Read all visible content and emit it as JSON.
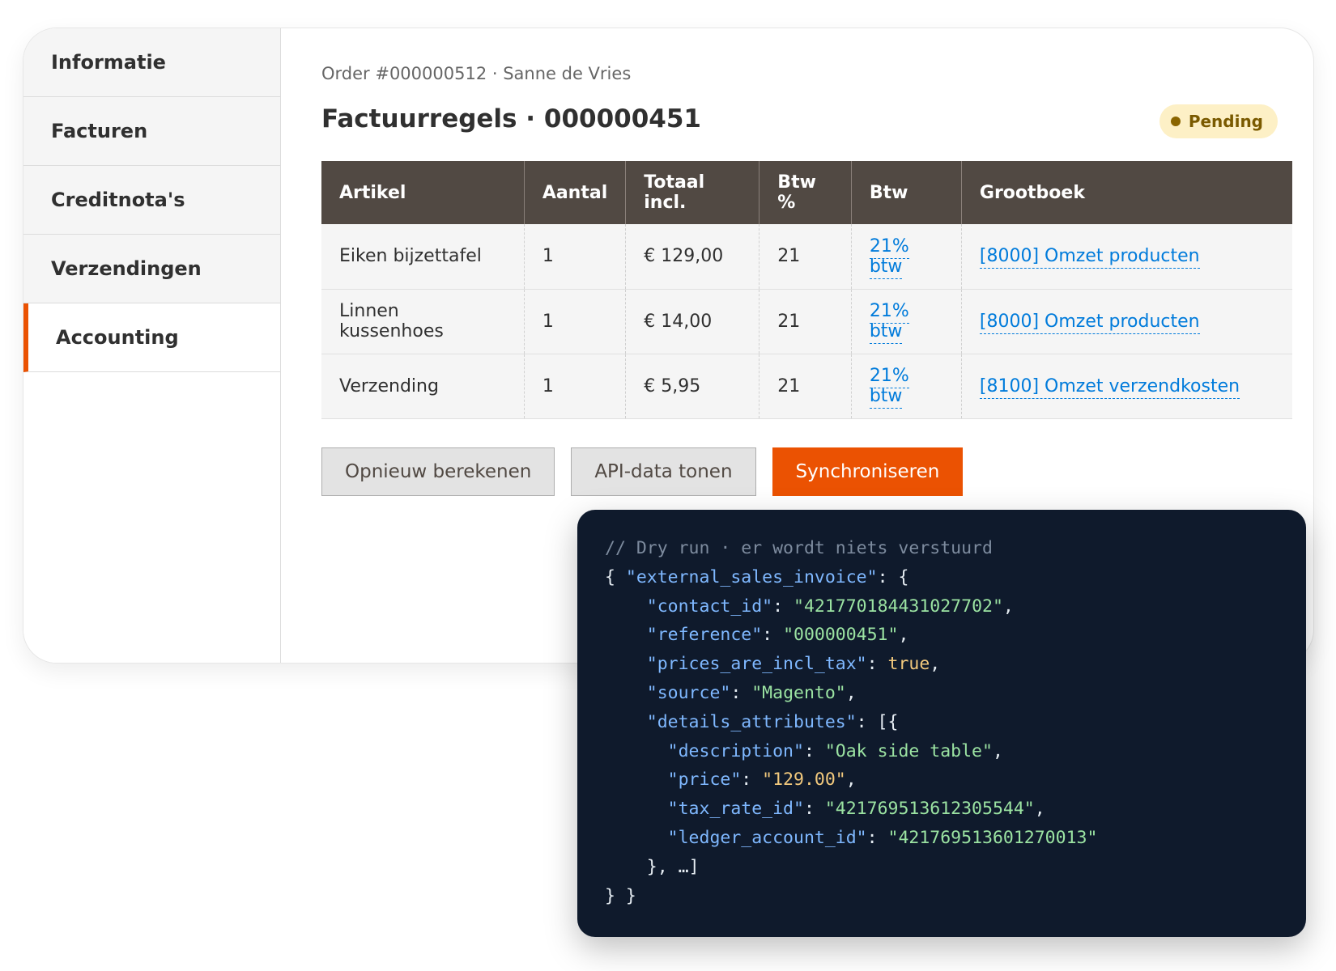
{
  "sidebar": {
    "items": [
      {
        "label": "Informatie"
      },
      {
        "label": "Facturen"
      },
      {
        "label": "Creditnota's"
      },
      {
        "label": "Verzendingen"
      },
      {
        "label": "Accounting"
      }
    ],
    "active": "Accounting"
  },
  "header": {
    "breadcrumb": "Order #000000512 · Sanne de Vries",
    "title": "Factuurregels · 000000451",
    "status": "Pending"
  },
  "table": {
    "columns": [
      "Artikel",
      "Aantal",
      "Totaal incl.",
      "Btw %",
      "Btw",
      "Grootboek"
    ],
    "rows": [
      {
        "artikel": "Eiken bijzettafel",
        "aantal": "1",
        "totaal": "€ 129,00",
        "btw_pct": "21",
        "btw": "21% btw",
        "grootboek": "[8000] Omzet producten"
      },
      {
        "artikel": "Linnen kussenhoes",
        "aantal": "1",
        "totaal": "€ 14,00",
        "btw_pct": "21",
        "btw": "21% btw",
        "grootboek": "[8000] Omzet producten"
      },
      {
        "artikel": "Verzending",
        "aantal": "1",
        "totaal": "€ 5,95",
        "btw_pct": "21",
        "btw": "21% btw",
        "grootboek": "[8100] Omzet verzendkosten"
      }
    ]
  },
  "actions": {
    "recalc": "Opnieuw berekenen",
    "show_api": "API-data tonen",
    "sync": "Synchroniseren"
  },
  "code": {
    "comment": "// Dry run · er wordt niets verstuurd",
    "root_key": "\"external_sales_invoice\"",
    "contact_key": "\"contact_id\"",
    "contact_val": "\"421770184431027702\"",
    "reference_key": "\"reference\"",
    "reference_val": "\"000000451\"",
    "incl_tax_key": "\"prices_are_incl_tax\"",
    "incl_tax_val": "true",
    "source_key": "\"source\"",
    "source_val": "\"Magento\"",
    "details_key": "\"details_attributes\"",
    "desc_key": "\"description\"",
    "desc_val": "\"Oak side table\"",
    "price_key": "\"price\"",
    "price_val": "\"129.00\"",
    "tax_key": "\"tax_rate_id\"",
    "tax_val": "\"421769513612305544\"",
    "ledger_key": "\"ledger_account_id\"",
    "ledger_val": "\"421769513601270013\"",
    "ellipsis": "…"
  },
  "colors": {
    "accent": "#eb5202",
    "header_bg": "#514943",
    "link": "#007bdb",
    "badge_bg": "#fdf0c6",
    "code_bg": "#0f1a2c"
  }
}
